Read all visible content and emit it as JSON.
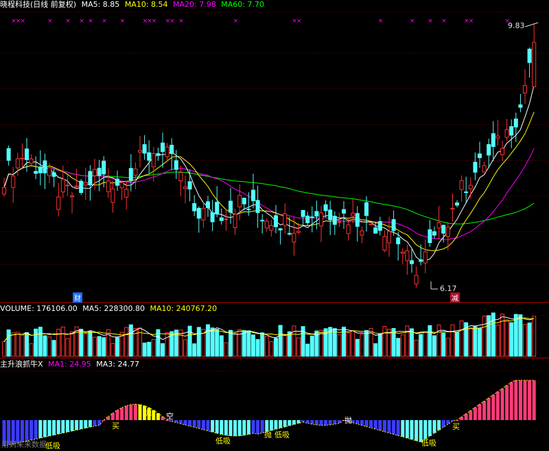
{
  "header_main": {
    "title": "晓程科技(日线 前复权)",
    "ma5_label": "MA5: 8.85",
    "ma10_label": "MA10: 8.54",
    "ma20_label": "MA20: 7.98",
    "ma60_label": "MA60: 7.70"
  },
  "header_volume": {
    "volume_label": "VOLUME: 176106.00",
    "ma5_label": "MA5: 228300.80",
    "ma10_label": "MA10: 240767.20"
  },
  "header_indicator": {
    "title": "主升浪抓牛X",
    "ma1_label": "MA1: 24.95",
    "ma3_label": "MA3: 24.77"
  },
  "annotations": {
    "high_price": "9.83",
    "low_price": "6.17",
    "finance_marker": "财",
    "news_marker": "减",
    "footer_text": "用到未来数据"
  },
  "indicator_signals": {
    "buy": "买",
    "sell": "抛",
    "short": "空",
    "low_buy": "低吸"
  },
  "colors": {
    "background": "#000000",
    "up_candle": "#ff3232",
    "down_candle": "#54ffff",
    "ma5": "#ffffff",
    "ma10": "#ffff00",
    "ma20": "#ff00ff",
    "ma60": "#00ff00",
    "grid": "#800000",
    "indicator_up": "#ff3c78",
    "indicator_down": "#3c3cff",
    "indicator_peak": "#ffff00"
  },
  "chart_data": {
    "type": "candlestick",
    "series_labels": [
      "MA5",
      "MA10",
      "MA20",
      "MA60"
    ],
    "price_range_visible": [
      6.17,
      9.83
    ],
    "last_values": {
      "ma5": 8.85,
      "ma10": 8.54,
      "ma20": 7.98,
      "ma60": 7.7,
      "volume": 176106.0,
      "volume_ma5": 228300.8,
      "volume_ma10": 240767.2,
      "indicator_ma1": 24.95,
      "indicator_ma3": 24.77
    },
    "highest_price": 9.83,
    "lowest_price": 6.17
  }
}
